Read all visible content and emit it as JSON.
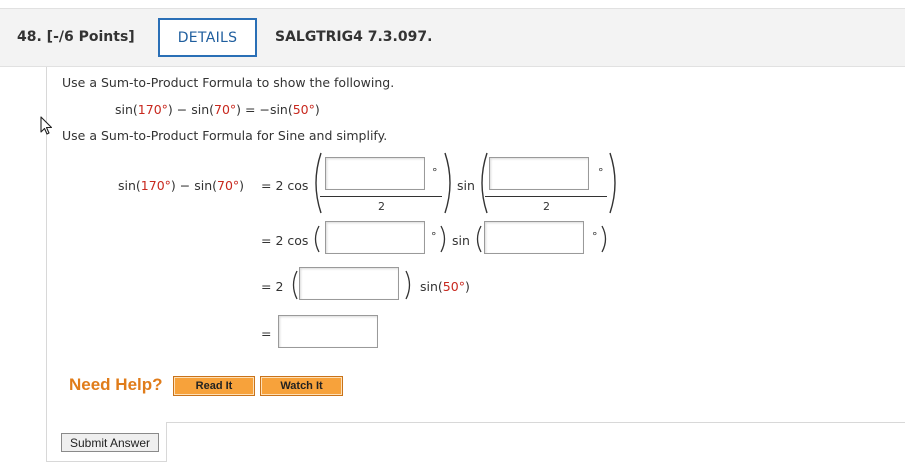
{
  "header": {
    "question_number": "48.  [-/6 Points]",
    "details_label": "DETAILS",
    "question_id": "SALGTRIG4 7.3.097."
  },
  "instructions": {
    "line1": "Use a Sum-to-Product Formula to show the following.",
    "line2": "Use a Sum-to-Product Formula for Sine and simplify."
  },
  "identity": {
    "sin1": "sin(",
    "arg1": "170°",
    "close1": ")",
    "minus": " − sin(",
    "arg2": "70°",
    "close2": ") = −sin(",
    "arg3": "50°",
    "close3": ")"
  },
  "steps": {
    "lhs_sin1": "sin(",
    "lhs_arg1": "170°",
    "lhs_mid": ") − sin(",
    "lhs_arg2": "70°",
    "lhs_close": ")",
    "eq1": "= 2 cos",
    "sin_label": "sin",
    "denominator": "2",
    "degree": "°",
    "eq2": "= 2 cos",
    "eq3": "= 2",
    "sin50_pre": "sin(",
    "sin50_arg": "50°",
    "sin50_close": ")",
    "eq4": "="
  },
  "help": {
    "need_help": "Need Help?",
    "read_it": "Read It",
    "watch_it": "Watch It"
  },
  "submit_label": "Submit Answer"
}
